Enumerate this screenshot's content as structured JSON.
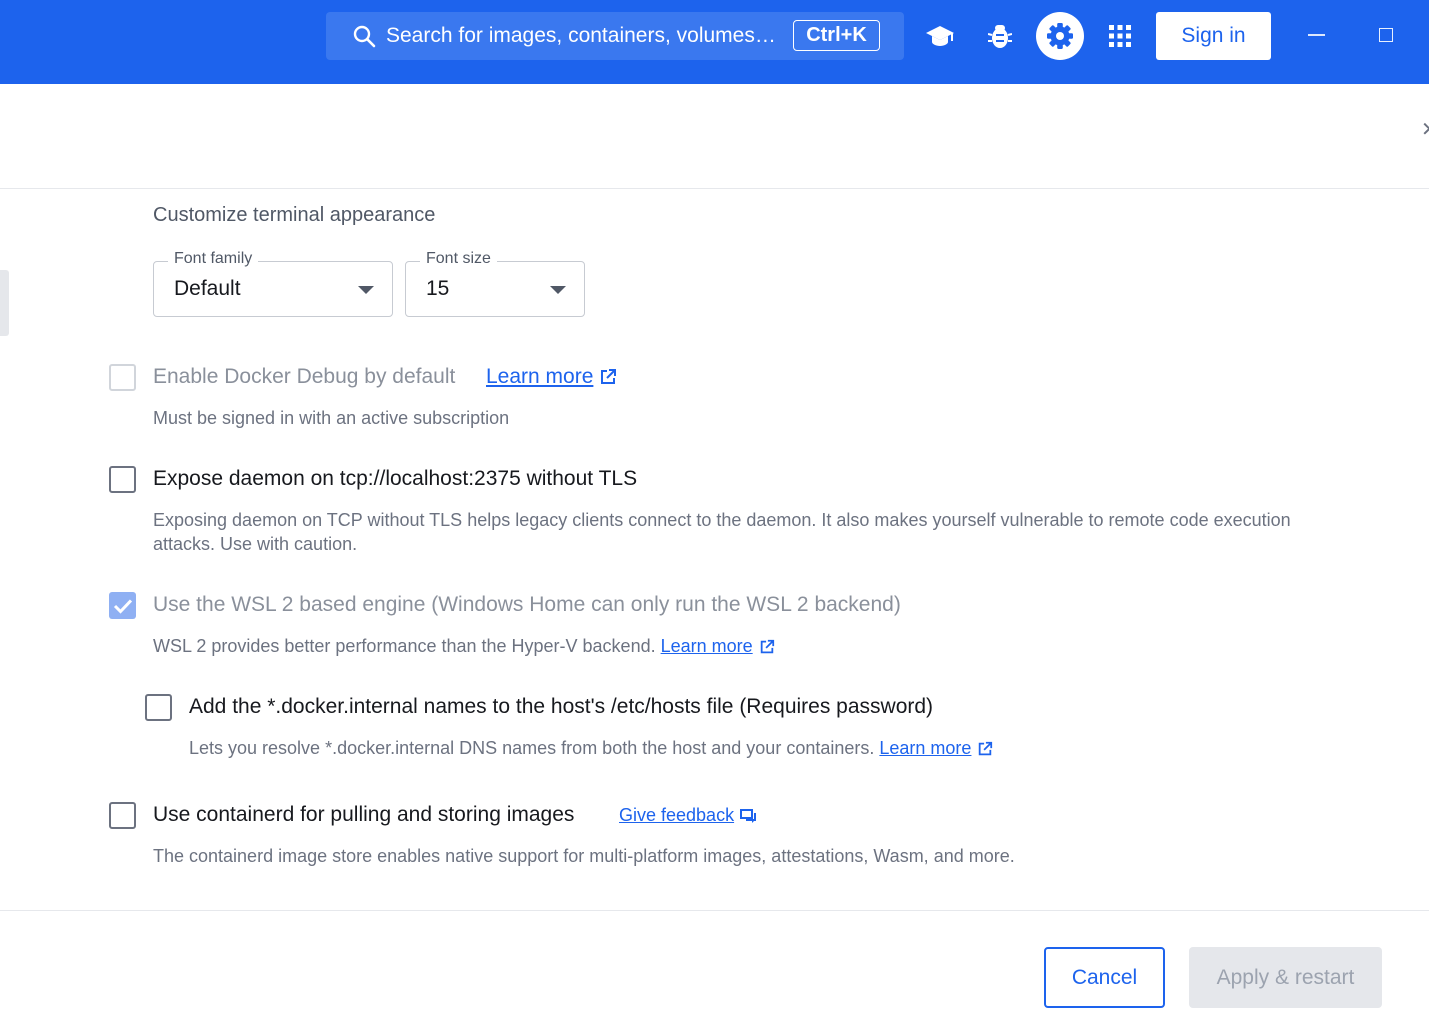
{
  "topbar": {
    "search_placeholder": "Search for images, containers, volumes…",
    "search_shortcut": "Ctrl+K",
    "signin_label": "Sign in",
    "icons": [
      "learning-center-icon",
      "troubleshoot-bug-icon",
      "settings-gear-icon",
      "extensions-grid-icon"
    ],
    "accent_color": "#1d63ed"
  },
  "content": {
    "section_title": "Customize terminal appearance",
    "font_family": {
      "legend": "Font family",
      "value": "Default"
    },
    "font_size": {
      "legend": "Font size",
      "value": "15"
    },
    "options": {
      "docker_debug": {
        "label": "Enable Docker Debug by default",
        "link": "Learn more",
        "help": "Must be signed in with an active subscription",
        "checked": false,
        "disabled": true
      },
      "expose_daemon": {
        "label": "Expose daemon on tcp://localhost:2375 without TLS",
        "help": "Exposing daemon on TCP without TLS helps legacy clients connect to the daemon. It also makes yourself vulnerable to remote code execution attacks. Use with caution.",
        "checked": false
      },
      "wsl2": {
        "label": "Use the WSL 2 based engine (Windows Home can only run the WSL 2 backend)",
        "help": "WSL 2 provides better performance than the Hyper-V backend.",
        "link": "Learn more",
        "checked": true,
        "disabled": true
      },
      "hosts_file": {
        "label": "Add the *.docker.internal names to the host's /etc/hosts file (Requires password)",
        "help": "Lets you resolve *.docker.internal DNS names from both the host and your containers.",
        "link": "Learn more",
        "checked": false
      },
      "containerd": {
        "label": "Use containerd for pulling and storing images",
        "link": "Give feedback",
        "help": "The containerd image store enables native support for multi-platform images, attestations, Wasm, and more.",
        "checked": false
      }
    }
  },
  "footer": {
    "cancel_label": "Cancel",
    "apply_label": "Apply & restart"
  }
}
